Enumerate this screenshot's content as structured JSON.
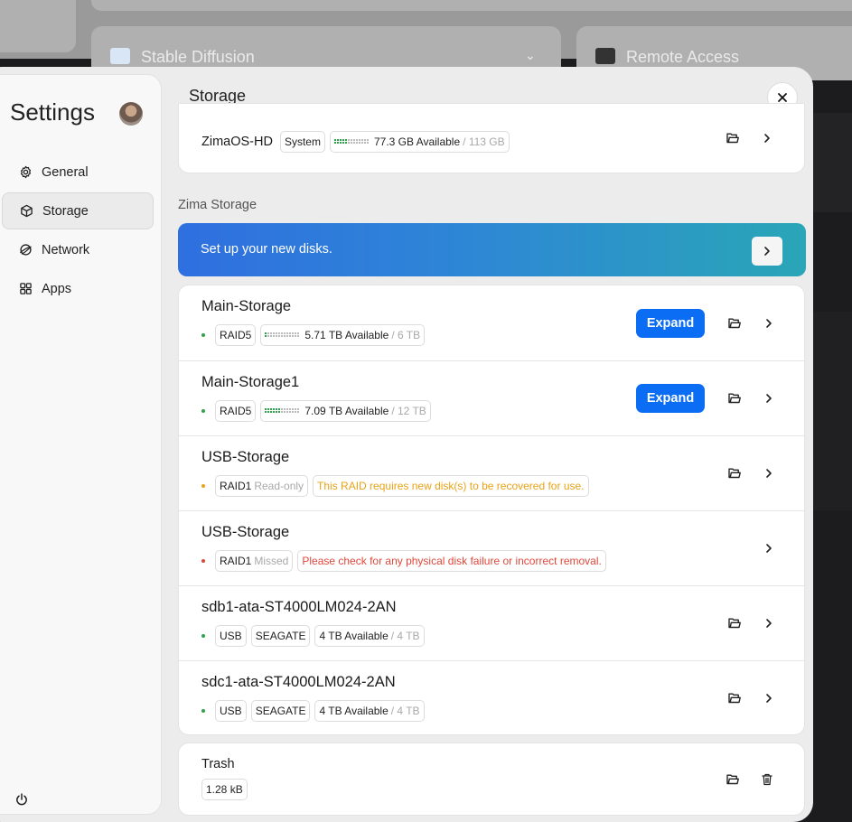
{
  "background": {
    "tiles": [
      {
        "label": "Stable Diffusion"
      },
      {
        "label": "Remote Access"
      }
    ]
  },
  "sidebar": {
    "title": "Settings",
    "items": [
      {
        "label": "General",
        "icon": "gear-icon",
        "active": false
      },
      {
        "label": "Storage",
        "icon": "cube-icon",
        "active": true
      },
      {
        "label": "Network",
        "icon": "globe-icon",
        "active": false
      },
      {
        "label": "Apps",
        "icon": "grid-icon",
        "active": false
      }
    ]
  },
  "main": {
    "title": "Storage",
    "system_disk": {
      "name": "ZimaOS-HD",
      "tag": "System",
      "available": "77.3 GB Available",
      "total": "/ 113 GB"
    },
    "zima_section_label": "Zima Storage",
    "banner": {
      "text": "Set up your new disks."
    },
    "expand_label": "Expand",
    "storages": [
      {
        "name": "Main-Storage",
        "status_color": "#2fa34a",
        "tags": [
          "RAID5"
        ],
        "available": "5.71 TB Available",
        "total": "/ 6 TB",
        "expand": true
      },
      {
        "name": "Main-Storage1",
        "status_color": "#2fa34a",
        "tags": [
          "RAID5"
        ],
        "available": "7.09 TB Available",
        "total": "/ 12 TB",
        "expand": true
      },
      {
        "name": "USB-Storage",
        "status_color": "#e8a317",
        "raid": "RAID1",
        "state": "Read-only",
        "message": "This RAID requires new disk(s) to be recovered for use."
      },
      {
        "name": "USB-Storage",
        "status_color": "#e0473a",
        "raid": "RAID1",
        "state": "Missed",
        "message": "Please check for any physical disk failure or incorrect removal."
      },
      {
        "name": "sdb1-ata-ST4000LM024-2AN",
        "status_color": "#2fa34a",
        "tags": [
          "USB",
          "SEAGATE"
        ],
        "available": "4 TB Available",
        "total": "/ 4 TB"
      },
      {
        "name": "sdc1-ata-ST4000LM024-2AN",
        "status_color": "#2fa34a",
        "tags": [
          "USB",
          "SEAGATE"
        ],
        "available": "4 TB Available",
        "total": "/ 4 TB"
      }
    ],
    "trash": {
      "name": "Trash",
      "size": "1.28 kB"
    }
  },
  "colors": {
    "accent": "#0b6cf4",
    "ok": "#2fa34a",
    "warn": "#e8a317",
    "error": "#e0473a"
  }
}
